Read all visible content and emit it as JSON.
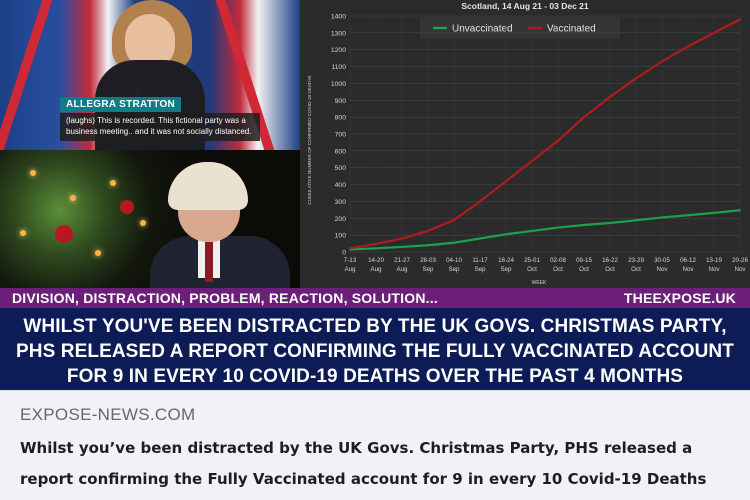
{
  "preview": {
    "domain": "EXPOSE-NEWS.COM",
    "title": "Whilst you’ve been distracted by the UK Govs. Christmas Party, PHS released a report confirming the Fully Vaccinated account for 9 in every 10 Covid-19 Deaths"
  },
  "thumbnail": {
    "lower_third": {
      "name": "ALLEGRA STRATTON",
      "quote": "(laughs) This is recorded. This fictional party was a business meeting.. and it was not socially distanced."
    },
    "ticker": {
      "left": "DIVISION, DISTRACTION, PROBLEM, REACTION, SOLUTION...",
      "right": "THEEXPOSE.UK"
    },
    "banner_lines": [
      "WHILST YOU'VE BEEN DISTRACTED BY THE UK GOVS. CHRISTMAS PARTY,",
      "PHS RELEASED A REPORT CONFIRMING THE FULLY VACCINATED ACCOUNT",
      "FOR 9 IN EVERY 10 COVID-19 DEATHS OVER THE PAST 4 MONTHS"
    ],
    "colors": {
      "ticker_bg": "#6b1f78",
      "banner_bg": "#0d1b56",
      "unvaccinated": "#1aa34a",
      "vaccinated": "#b01c1c"
    }
  },
  "chart_data": {
    "type": "line",
    "title": "Scotland, 14 Aug 21 - 03 Dec 21",
    "xlabel": "WEEK",
    "ylabel": "CUMULATIVE NUMBER OF CONFIRMED COVID-19 DEATHS",
    "ylim": [
      0,
      1400
    ],
    "yticks": [
      0,
      100,
      200,
      300,
      400,
      500,
      600,
      700,
      800,
      900,
      1000,
      1100,
      1200,
      1300,
      1400
    ],
    "grid": true,
    "legend_position": "top",
    "categories": [
      [
        "7-13",
        "Aug"
      ],
      [
        "14-20",
        "Aug"
      ],
      [
        "21-27",
        "Aug"
      ],
      [
        "28-03",
        "Sep"
      ],
      [
        "04-10",
        "Sep"
      ],
      [
        "11-17",
        "Sep"
      ],
      [
        "18-24",
        "Sep"
      ],
      [
        "25-01",
        "Oct"
      ],
      [
        "02-08",
        "Oct"
      ],
      [
        "09-15",
        "Oct"
      ],
      [
        "16-22",
        "Oct"
      ],
      [
        "23-29",
        "Oct"
      ],
      [
        "30-05",
        "Nov"
      ],
      [
        "06-12",
        "Nov"
      ],
      [
        "13-19",
        "Nov"
      ],
      [
        "20-26",
        "Nov"
      ]
    ],
    "series": [
      {
        "name": "Unvaccinated",
        "color": "#1aa34a",
        "values": [
          15,
          22,
          30,
          40,
          55,
          80,
          105,
          125,
          145,
          160,
          172,
          188,
          205,
          218,
          232,
          248
        ]
      },
      {
        "name": "Vaccinated",
        "color": "#b01c1c",
        "values": [
          22,
          48,
          80,
          125,
          190,
          300,
          420,
          540,
          660,
          800,
          920,
          1030,
          1130,
          1220,
          1300,
          1380
        ]
      }
    ]
  }
}
